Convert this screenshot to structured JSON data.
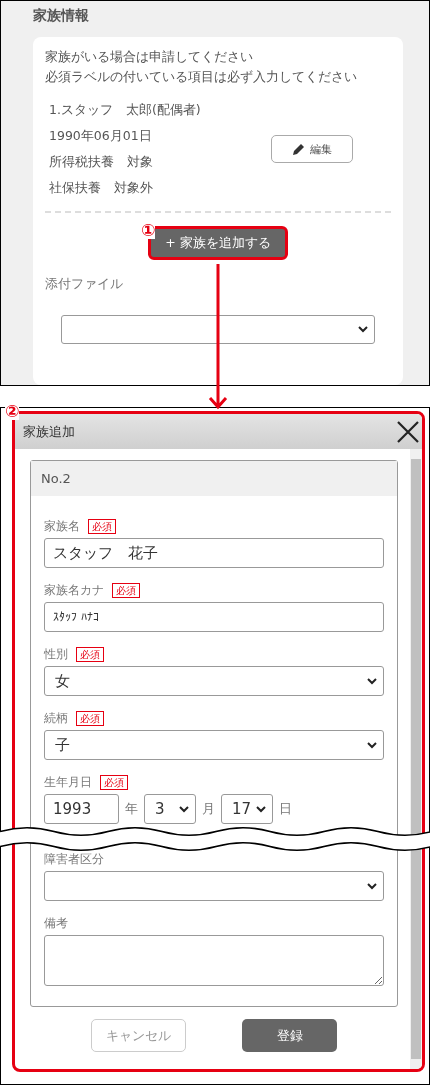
{
  "page_section": {
    "title": "家族情報",
    "notes": [
      "家族がいる場合は申請してください",
      "必須ラベルの付いている項目は必ず入力してください"
    ],
    "family_members": [
      {
        "lines": [
          "1.スタッフ　太郎(配偶者)",
          "1990年06月01日",
          "所得税扶養　対象",
          "社保扶養　対象外"
        ],
        "edit_button": "編集"
      }
    ],
    "add_button": "+ 家族を追加する",
    "attachment_label": "添付ファイル"
  },
  "callouts": [
    "①",
    "②"
  ],
  "modal": {
    "title": "家族追加",
    "card_header": "No.2",
    "fields_top": [
      {
        "kind": "text",
        "label": "家族名",
        "required_badge": "必須",
        "value": "スタッフ　花子"
      },
      {
        "kind": "text",
        "label": "家族名カナ",
        "required_badge": "必須",
        "value": "ｽﾀｯﾌ ﾊﾅｺ"
      },
      {
        "kind": "select",
        "label": "性別",
        "required_badge": "必須",
        "value": "女"
      },
      {
        "kind": "select",
        "label": "続柄",
        "required_badge": "必須",
        "value": "子"
      },
      {
        "kind": "date",
        "label": "生年月日",
        "required_badge": "必須",
        "year": "1993",
        "year_unit": "年",
        "month": "3",
        "month_unit": "月",
        "day": "17",
        "day_unit": "日"
      }
    ],
    "fields_bottom": [
      {
        "kind": "select",
        "label": "障害者区分"
      },
      {
        "kind": "textarea",
        "label": "備考"
      }
    ],
    "cancel_button": "キャンセル",
    "submit_button": "登録"
  }
}
